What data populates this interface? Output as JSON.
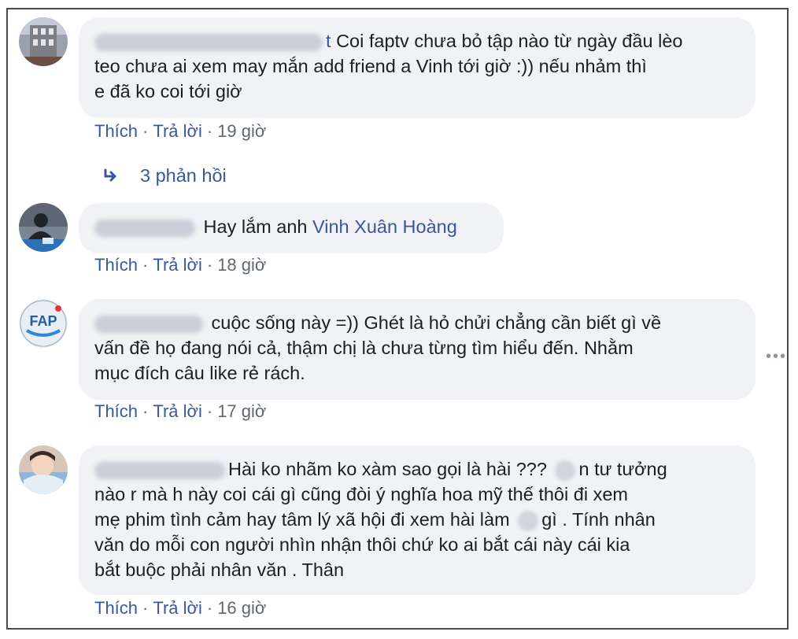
{
  "comments": [
    {
      "text_suffix": "t",
      "text": "Coi faptv chưa bỏ tập nào từ ngày đầu lèo teo chưa ai xem may mắn add friend a Vinh tới giờ :)) nếu nhảm thì e đã ko coi tới giờ",
      "line1": "Coi faptv chưa bỏ tập nào từ ngày đầu lèo",
      "line2": "teo chưa ai xem may mắn add friend a Vinh tới giờ :)) nếu nhảm thì",
      "line3": "e đã ko coi tới giờ",
      "like": "Thích",
      "reply": "Trả lời",
      "time": "19 giờ"
    },
    {
      "text": "Hay lắm anh",
      "mention": "Vinh Xuân Hoàng",
      "like": "Thích",
      "reply": "Trả lời",
      "time": "18 giờ"
    },
    {
      "line1": "cuộc sống này =)) Ghét là hỏ chửi chẳng cần biết gì về",
      "line2": "vấn đề họ đang nói cả, thậm chị là chưa từng tìm hiểu đến. Nhằm",
      "line3": "mục đích câu like rẻ rách.",
      "like": "Thích",
      "reply": "Trả lời",
      "time": "17 giờ"
    },
    {
      "line1a": "Hài ko nhãm ko xàm sao gọi là hài ???",
      "line1b": "n tư tưởng",
      "line2": "nào r mà h này coi cái gì cũng đòi ý nghĩa hoa mỹ thế thôi đi xem",
      "line3a": "mẹ phim tình cảm hay tâm lý xã hội đi xem hài làm",
      "line3b": "gì . Tính nhân",
      "line4": "văn do mỗi con người nhìn nhận thôi chứ ko ai bắt cái này cái kia",
      "line5": "bắt buộc phải nhân văn . Thân",
      "like": "Thích",
      "reply": "Trả lời",
      "time": "16 giờ"
    }
  ],
  "replies_label": "3 phản hồi",
  "separator": "·",
  "more_icon": "more-options-icon",
  "colors": {
    "bubble": "#f0f2f5",
    "link": "#385898",
    "meta": "#606770",
    "text": "#1c1e21"
  }
}
